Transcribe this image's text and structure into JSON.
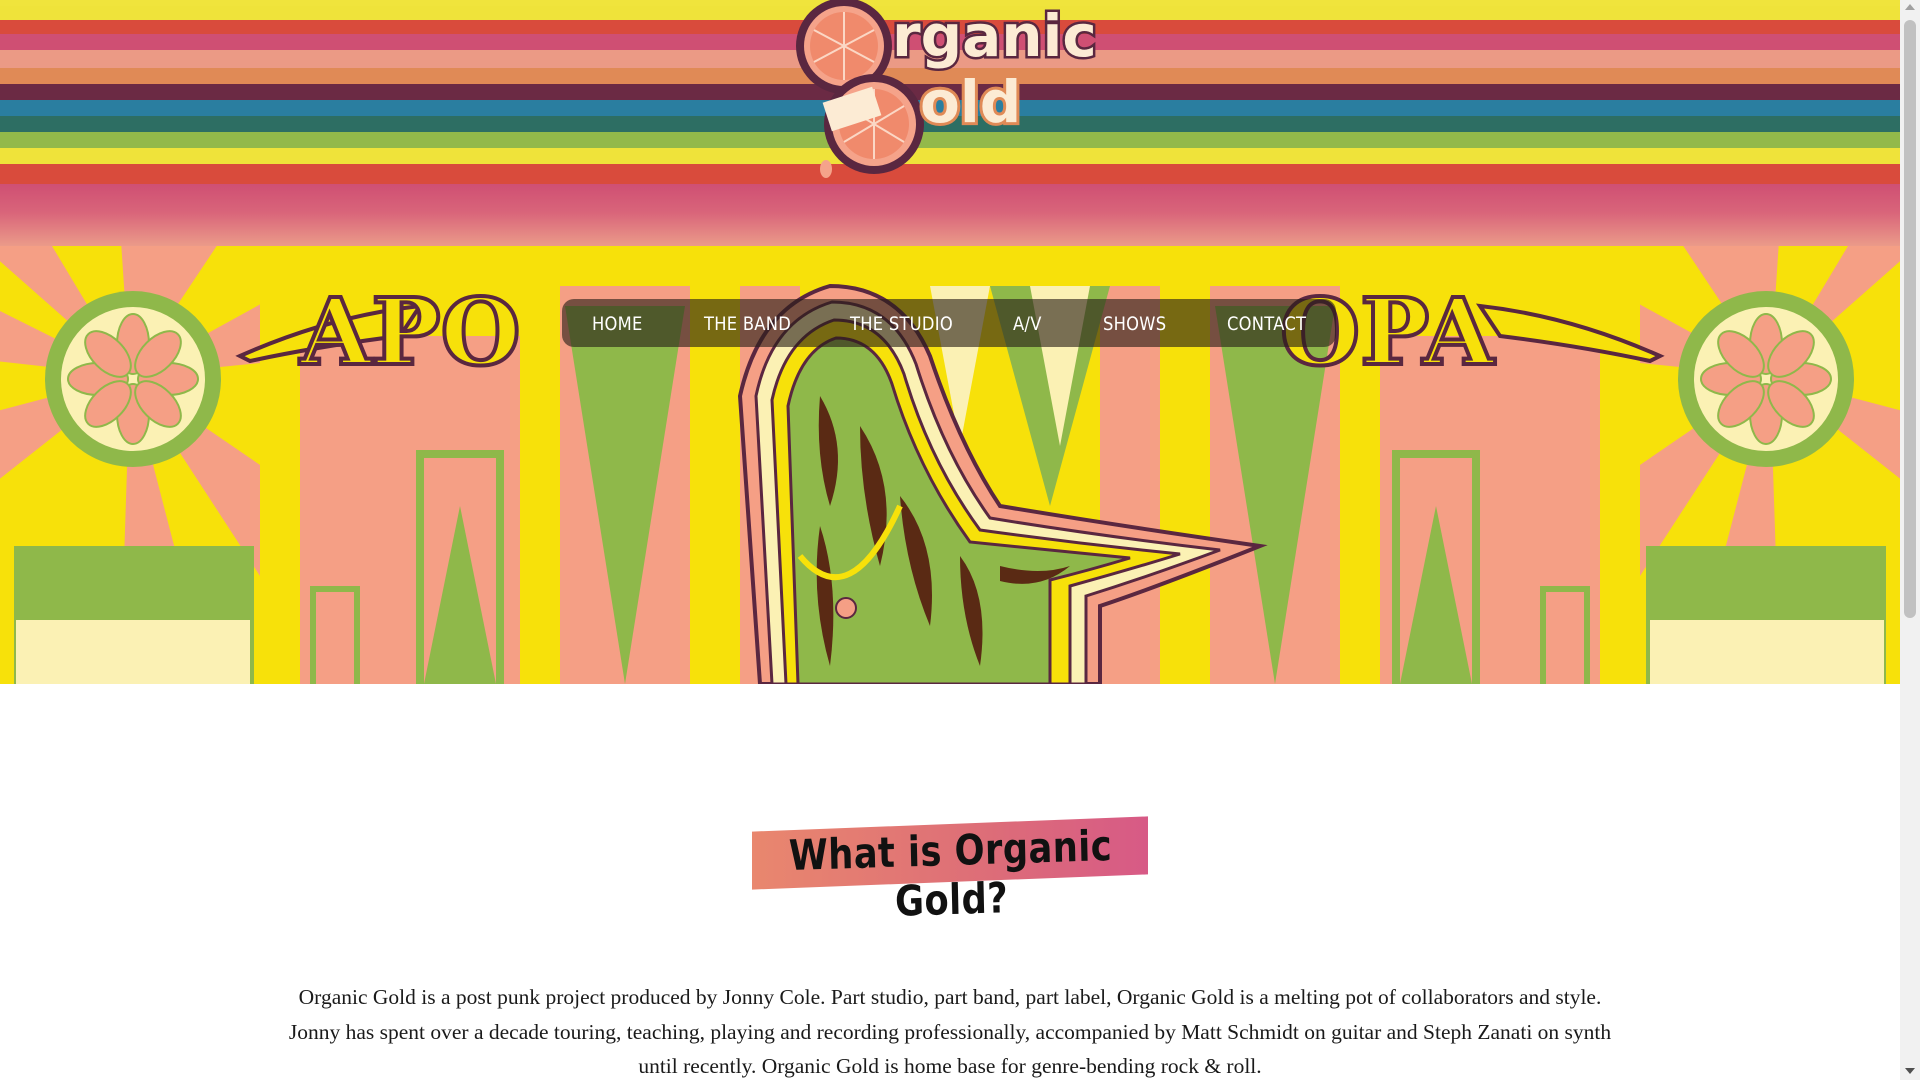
{
  "site": {
    "logo_text": "Organic Gold"
  },
  "nav": {
    "items": [
      {
        "label": "HOME"
      },
      {
        "label": "THE BAND"
      },
      {
        "label": "THE STUDIO"
      },
      {
        "label": "A/V"
      },
      {
        "label": "SHOWS"
      },
      {
        "label": "CONTACT"
      }
    ]
  },
  "hero": {
    "artwork_text": "APOLLO"
  },
  "intro": {
    "heading": "What is Organic Gold?",
    "lines": [
      "Organic Gold is a post punk project produced by Jonny Cole. Part studio, part band, part label, Organic Gold is a melting pot of collaborators and style.",
      "Jonny has spent over a decade touring, teaching, playing and recording professionally, accompanied by Matt Schmidt on guitar and Steph Zanati on synth",
      "until recently. Organic Gold is home base for genre-bending rock & roll."
    ]
  },
  "colors": {
    "stripe_yellow": "#efe33a",
    "stripe_red": "#d94b3c",
    "stripe_pink": "#cf4f73",
    "stripe_salmon": "#eb9a85",
    "stripe_orange": "#e08a56",
    "stripe_plum": "#6b2a44",
    "stripe_blue": "#2a7ea0",
    "stripe_teal": "#2d6e63",
    "stripe_green": "#93b94a",
    "hero_yellow": "#f7e10a",
    "hero_salmon": "#f59f85",
    "hero_green": "#8fb84a",
    "hero_cream": "#fbf1b4",
    "logo_plum": "#5a2740",
    "logo_cream": "#fcebd4"
  }
}
